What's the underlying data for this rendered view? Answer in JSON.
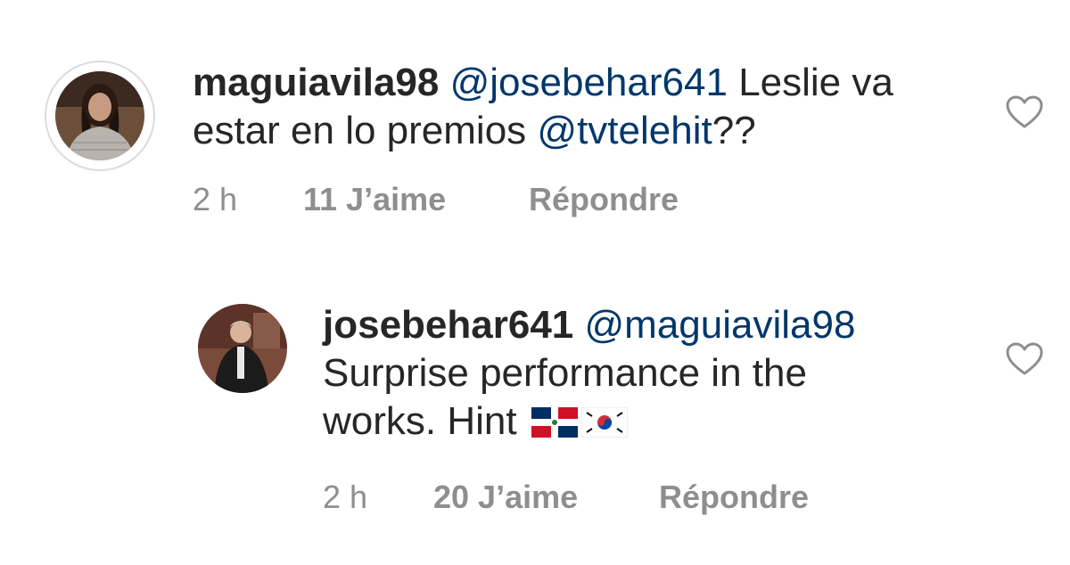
{
  "comments": [
    {
      "username": "maguiavila98",
      "mention": "@josebehar641",
      "text_line1": "Leslie va",
      "text_line2_prefix": "estar en lo premios ",
      "text_line2_mention": "@tvtelehit",
      "text_line2_suffix": "??",
      "time": "2 h",
      "likes": "11 J’aime",
      "reply": "Répondre"
    },
    {
      "username": "josebehar641",
      "mention": "@maguiavila98",
      "text_line1": "Surprise performance in the",
      "text_line2": "works. Hint",
      "flags": [
        "dominican-republic-flag",
        "south-korea-flag"
      ],
      "time": "2 h",
      "likes": "20 J’aime",
      "reply": "Répondre"
    }
  ],
  "icons": {
    "like": "heart-outline-icon"
  },
  "colors": {
    "text": "#262626",
    "mention": "#00376b",
    "meta": "#8e8e8e"
  }
}
